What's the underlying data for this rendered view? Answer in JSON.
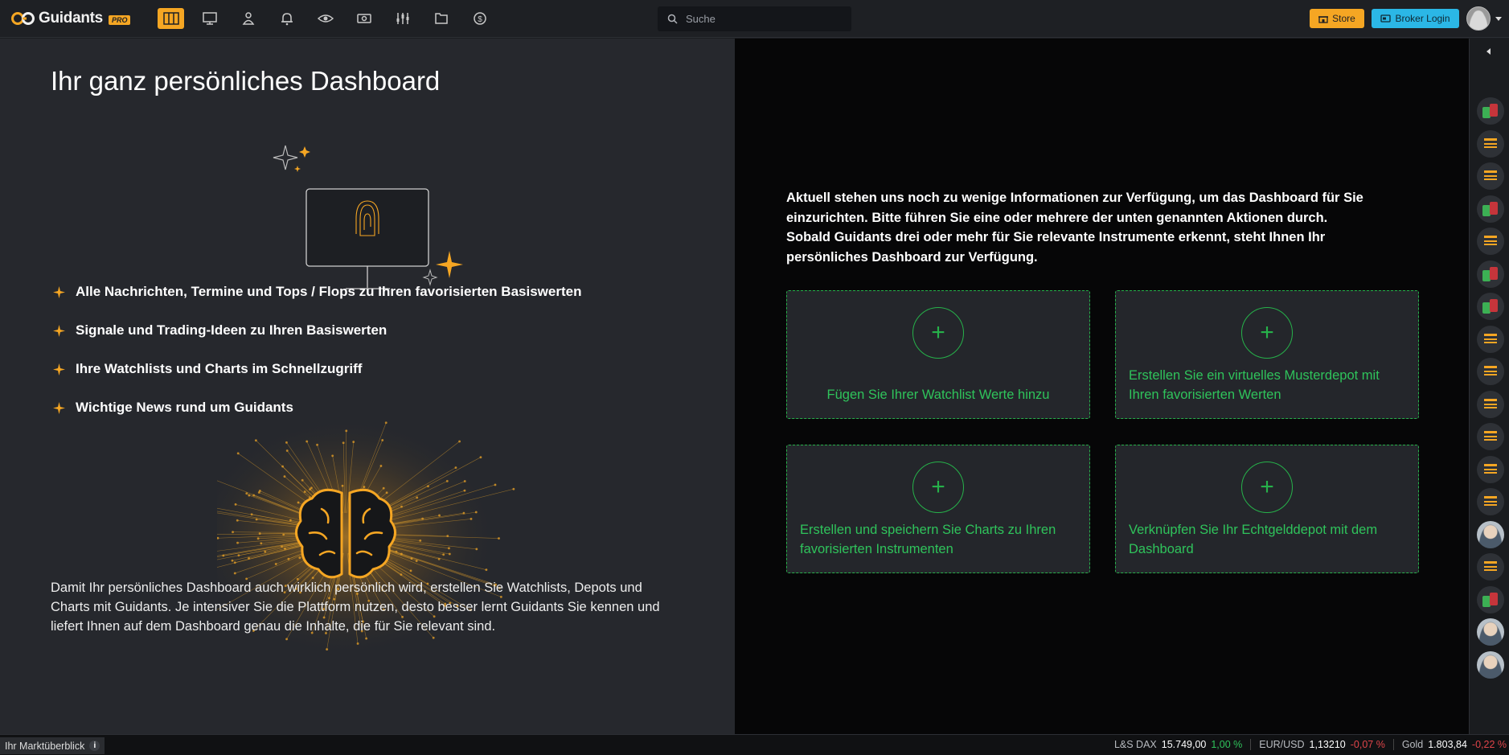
{
  "header": {
    "logo_text": "Guidants",
    "logo_badge": "PRO",
    "nav": [
      {
        "icon": "dashboard-icon",
        "active": true
      },
      {
        "icon": "desktop-icon"
      },
      {
        "icon": "community-icon"
      },
      {
        "icon": "bell-icon"
      },
      {
        "icon": "eye-icon"
      },
      {
        "icon": "depot-icon"
      },
      {
        "icon": "chart-tools-icon"
      },
      {
        "icon": "folder-icon"
      },
      {
        "icon": "dollar-icon"
      }
    ],
    "search_placeholder": "Suche",
    "store_label": "Store",
    "broker_label": "Broker Login"
  },
  "left": {
    "title": "Ihr ganz persönliches Dashboard",
    "features": [
      "Alle Nachrichten, Termine und Tops / Flops zu Ihren favorisierten Basiswerten",
      "Signale und Trading-Ideen zu Ihren Basiswerten",
      "Ihre Watchlists und Charts im Schnellzugriff",
      "Wichtige News rund um Guidants"
    ],
    "description": "Damit Ihr persönliches Dashboard auch wirklich persönlich wird, erstellen Sie Watchlists, Depots und Charts mit Guidants. Je intensiver Sie die Plattform nutzen, desto besser lernt Guidants Sie kennen und liefert Ihnen auf dem Dashboard genau die Inhalte, die für Sie relevant sind."
  },
  "right": {
    "intro": "Aktuell stehen uns noch zu wenige Informationen zur Verfügung, um das Dashboard für Sie einzurichten. Bitte führen Sie eine oder mehrere der unten genannten Aktionen durch. Sobald Guidants drei oder mehr für Sie relevante Instrumente erkennt, steht Ihnen Ihr persönliches Dashboard zur Verfügung.",
    "cards": [
      {
        "label": "Fügen Sie Ihrer Watchlist Werte hinzu",
        "plus": "+"
      },
      {
        "label": "Erstellen Sie ein virtuelles Musterdepot mit Ihren favorisierten Werten",
        "plus": "+"
      },
      {
        "label": "Erstellen und speichern Sie Charts zu Ihren favorisierten Instrumenten",
        "plus": "+"
      },
      {
        "label": "Verknüpfen Sie Ihr Echtgelddepot mit dem Dashboard",
        "plus": "+"
      }
    ]
  },
  "rail": {
    "items": [
      "depot",
      "news",
      "news",
      "depot",
      "news",
      "depot",
      "depot",
      "news",
      "news",
      "news",
      "news",
      "news",
      "news",
      "person",
      "news",
      "depot",
      "person",
      "person"
    ]
  },
  "footer": {
    "market_label": "Ihr Marktüberblick",
    "info_glyph": "i",
    "quotes": [
      {
        "name": "L&S DAX",
        "value": "15.749,00",
        "change": "1,00 %",
        "dir": "up"
      },
      {
        "name": "EUR/USD",
        "value": "1,13210",
        "change": "-0,07 %",
        "dir": "down"
      },
      {
        "name": "Gold",
        "value": "1.803,84",
        "change": "-0,22 %",
        "dir": "down"
      }
    ]
  },
  "colors": {
    "accent_orange": "#f5a623",
    "accent_green": "#26b14a",
    "accent_blue": "#2bb7e6",
    "negative_red": "#e0454a"
  }
}
